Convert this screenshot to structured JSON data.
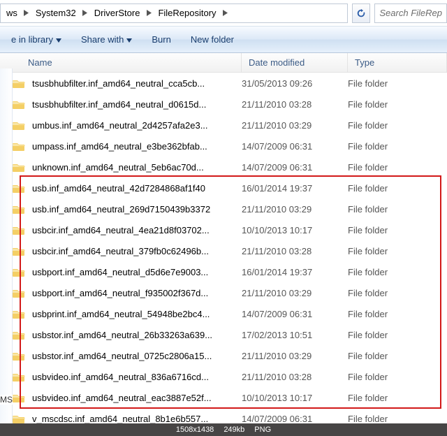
{
  "breadcrumbs": [
    "ws",
    "System32",
    "DriverStore",
    "FileRepository"
  ],
  "search_placeholder": "Search FileRep",
  "toolbar": {
    "include": "e in library",
    "share": "Share with",
    "burn": "Burn",
    "newfolder": "New folder"
  },
  "columns": {
    "name": "Name",
    "date": "Date modified",
    "type": "Type"
  },
  "type_label": "File folder",
  "rows": [
    {
      "name": "tsusbhubfilter.inf_amd64_neutral_cca5cb...",
      "date": "31/05/2013 09:26"
    },
    {
      "name": "tsusbhubfilter.inf_amd64_neutral_d0615d...",
      "date": "21/11/2010 03:28"
    },
    {
      "name": "umbus.inf_amd64_neutral_2d4257afa2e3...",
      "date": "21/11/2010 03:29"
    },
    {
      "name": "umpass.inf_amd64_neutral_e3be362bfab...",
      "date": "14/07/2009 06:31"
    },
    {
      "name": "unknown.inf_amd64_neutral_5eb6ac70d...",
      "date": "14/07/2009 06:31"
    },
    {
      "name": "usb.inf_amd64_neutral_42d7284868af1f40",
      "date": "16/01/2014 19:37"
    },
    {
      "name": "usb.inf_amd64_neutral_269d7150439b3372",
      "date": "21/11/2010 03:29"
    },
    {
      "name": "usbcir.inf_amd64_neutral_4ea21d8f03702...",
      "date": "10/10/2013 10:17"
    },
    {
      "name": "usbcir.inf_amd64_neutral_379fb0c62496b...",
      "date": "21/11/2010 03:28"
    },
    {
      "name": "usbport.inf_amd64_neutral_d5d6e7e9003...",
      "date": "16/01/2014 19:37"
    },
    {
      "name": "usbport.inf_amd64_neutral_f935002f367d...",
      "date": "21/11/2010 03:29"
    },
    {
      "name": "usbprint.inf_amd64_neutral_54948be2bc4...",
      "date": "14/07/2009 06:31"
    },
    {
      "name": "usbstor.inf_amd64_neutral_26b33263a639...",
      "date": "17/02/2013 10:51"
    },
    {
      "name": "usbstor.inf_amd64_neutral_0725c2806a15...",
      "date": "21/11/2010 03:29"
    },
    {
      "name": "usbvideo.inf_amd64_neutral_836a6716cd...",
      "date": "21/11/2010 03:28"
    },
    {
      "name": "usbvideo.inf_amd64_neutral_eac3887e52f...",
      "date": "10/10/2013 10:17"
    },
    {
      "name": "v_mscdsc.inf_amd64_neutral_8b1e6b557...",
      "date": "14/07/2009 06:31"
    }
  ],
  "highlight": {
    "start": 5,
    "end": 15
  },
  "sidebar_fragment": "MS",
  "footer": {
    "dims": "1508x1438",
    "size": "249kb",
    "fmt": "PNG"
  }
}
